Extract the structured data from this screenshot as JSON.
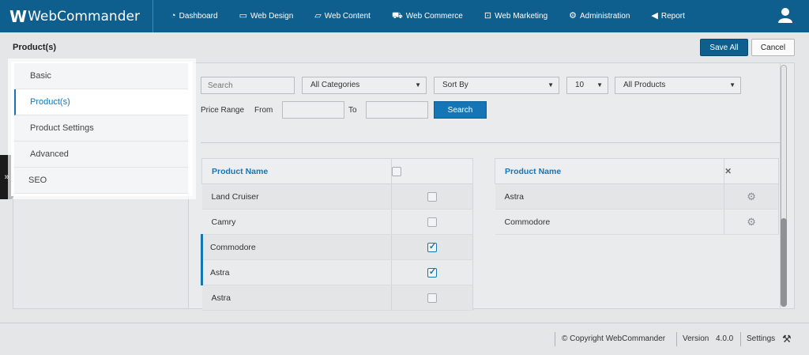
{
  "app": {
    "logo_mark": "W",
    "logo_text": "WebCommander"
  },
  "nav": [
    {
      "label": "Dashboard",
      "icon": "dashboard-icon",
      "glyph": "◔"
    },
    {
      "label": "Web Design",
      "icon": "monitor-icon",
      "glyph": "▭"
    },
    {
      "label": "Web Content",
      "icon": "folder-icon",
      "glyph": "▱"
    },
    {
      "label": "Web Commerce",
      "icon": "cart-icon",
      "glyph": "⛟"
    },
    {
      "label": "Web Marketing",
      "icon": "chart-icon",
      "glyph": "⊡"
    },
    {
      "label": "Administration",
      "icon": "gear-icon",
      "glyph": "⚙"
    },
    {
      "label": "Report",
      "icon": "megaphone-icon",
      "glyph": "◀"
    }
  ],
  "header": {
    "title": "Product(s)",
    "save_label": "Save All",
    "cancel_label": "Cancel"
  },
  "sidemenu": [
    "Basic",
    "Product(s)",
    "Product Settings",
    "Advanced",
    "SEO"
  ],
  "filters": {
    "search_placeholder": "Search",
    "category": "All Categories",
    "sort": "Sort By",
    "count": "10",
    "products": "All Products",
    "price_range_label": "Price Range",
    "from_label": "From",
    "to_label": "To",
    "search_button": "Search"
  },
  "left_table": {
    "header": "Product Name",
    "rows": [
      {
        "name": "Land Cruiser",
        "checked": false
      },
      {
        "name": "Camry",
        "checked": false
      },
      {
        "name": "Commodore",
        "checked": true
      },
      {
        "name": "Astra",
        "checked": true
      },
      {
        "name": "Astra",
        "checked": false
      }
    ]
  },
  "right_table": {
    "header": "Product Name",
    "rows": [
      "Astra",
      "Commodore"
    ]
  },
  "footer": {
    "copyright": "© Copyright WebCommander",
    "version_label": "Version",
    "version": "4.0.0",
    "settings": "Settings"
  }
}
